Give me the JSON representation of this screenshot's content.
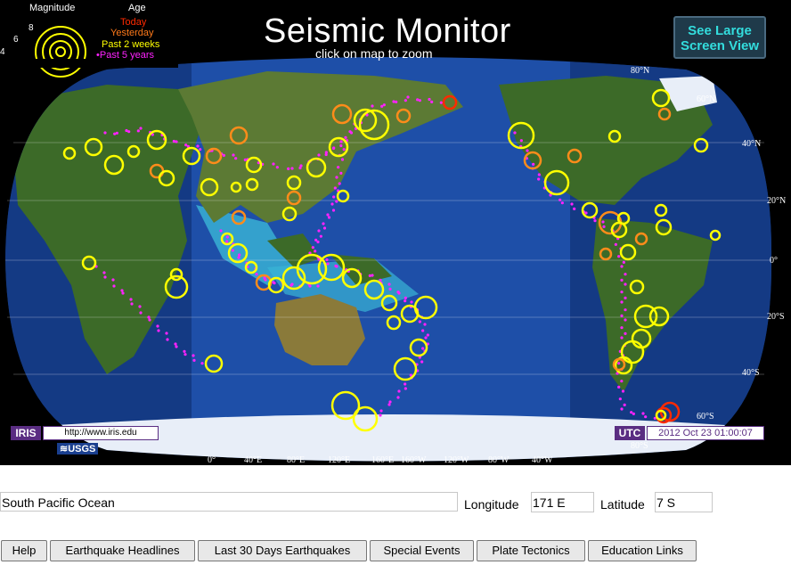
{
  "header": {
    "title": "Seismic Monitor",
    "subtitle": "click on map to zoom",
    "large_view_button": "See Large Screen View"
  },
  "legend": {
    "magnitude_title": "Magnitude",
    "age_title": "Age",
    "magnitudes": [
      "8",
      "6",
      "4"
    ],
    "ages": [
      {
        "label": "Today",
        "color": "#ff2a00"
      },
      {
        "label": "Yesterday",
        "color": "#ff7a1a"
      },
      {
        "label": "Past 2 weeks",
        "color": "#ffff00"
      },
      {
        "label": "Past 5 years",
        "color": "#ff22ff"
      }
    ]
  },
  "map": {
    "lat_labels": [
      "80°N",
      "60°N",
      "40°N",
      "20°N",
      "0°",
      "20°S",
      "40°S",
      "60°S",
      "80°S"
    ],
    "lon_labels": [
      "0°",
      "40°E",
      "80°E",
      "120°E",
      "160°E",
      "160°W",
      "120°W",
      "80°W",
      "40°W"
    ],
    "ocean_color": "#1e4fa8",
    "land_color": "#3c6a28",
    "iris_logo": "IRIS",
    "iris_url": "http://www.iris.edu",
    "usgs_logo": "≋USGS",
    "utc_label": "UTC",
    "utc_time": "2012 Oct 23 01:00:07"
  },
  "location": {
    "region": "South Pacific Ocean",
    "longitude_label": "Longitude",
    "longitude_value": "171 E",
    "latitude_label": "Latitude",
    "latitude_value": "7 S"
  },
  "nav": {
    "buttons": [
      "Help",
      "Earthquake Headlines",
      "Last 30 Days Earthquakes",
      "Special Events",
      "Plate Tectonics",
      "Education Links"
    ]
  }
}
